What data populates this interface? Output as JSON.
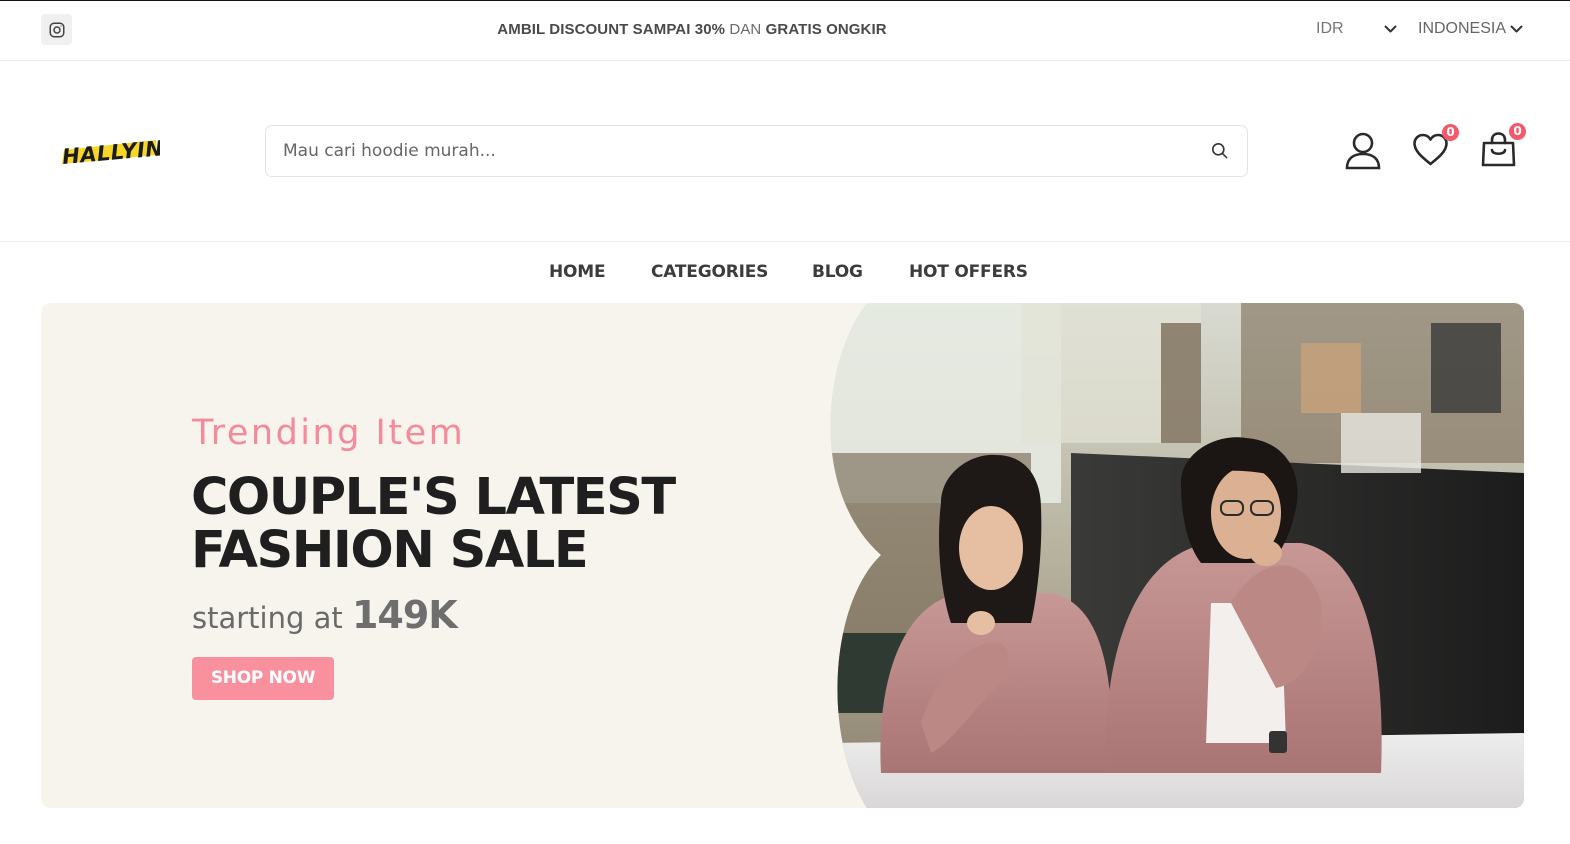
{
  "topbar": {
    "social_icon": "instagram-icon",
    "promo": {
      "part1": "AMBIL DISCOUNT SAMPAI 30%",
      "part2": "DAN",
      "part3": "GRATIS ONGKIR"
    },
    "currency": "IDR",
    "language": "INDONESIA"
  },
  "header": {
    "logo_text": "HALLYIN",
    "search": {
      "placeholder": "Mau cari hoodie murah..."
    },
    "wishlist_count": "0",
    "cart_count": "0"
  },
  "nav": {
    "items": [
      {
        "label": "HOME"
      },
      {
        "label": "CATEGORIES"
      },
      {
        "label": "BLOG"
      },
      {
        "label": "HOT OFFERS"
      }
    ]
  },
  "hero": {
    "eyebrow": "Trending Item",
    "headline_line1": "COUPLE'S LATEST",
    "headline_line2": "FASHION SALE",
    "price_prefix": "starting at",
    "price_value": "149K",
    "cta": "SHOP NOW"
  },
  "colors": {
    "accent_pink": "#f8909e",
    "eyebrow_pink": "#f48a9a",
    "badge_red": "#f25a6b",
    "hero_bg": "#f7f4ee",
    "logo_yellow": "#f5d629"
  }
}
